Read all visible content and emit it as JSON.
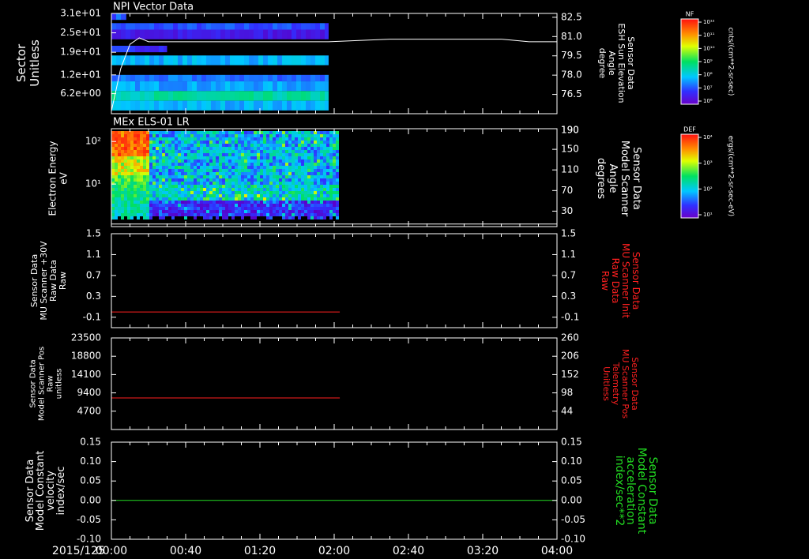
{
  "colors": {
    "background": "#000000",
    "foreground": "#ffffff",
    "red": "#ff2020",
    "green": "#22dd22"
  },
  "time_axis": {
    "date": "2015/125",
    "ticks": [
      "00:00",
      "00:40",
      "01:20",
      "02:00",
      "02:40",
      "03:20",
      "04:00"
    ],
    "range_minutes": [
      0,
      240
    ]
  },
  "chart_data": [
    {
      "type": "heatmap",
      "title": "NPI Vector Data",
      "ylabel": [
        "Sector",
        "Unitless"
      ],
      "ytick_labels": [
        "3.1e+01",
        "2.5e+01",
        "1.9e+01",
        "1.2e+01",
        "6.2e+00"
      ],
      "ytick_values": [
        31,
        25,
        19,
        12,
        6.2
      ],
      "ylim": [
        0,
        31
      ],
      "data_extent_minutes": [
        0,
        117
      ],
      "colorbar": {
        "tag": "NF",
        "label": "cnts/(cm**2-sr-sec)",
        "tick_labels": [
          "10¹²",
          "10¹¹",
          "10¹⁰",
          "10⁹",
          "10⁸",
          "10⁷",
          "10⁶"
        ]
      },
      "bands": [
        {
          "y": [
            29,
            31
          ],
          "x_end": 8,
          "level": 0.2
        },
        {
          "y": [
            24,
            28
          ],
          "x_end": 117,
          "level": 0.18
        },
        {
          "y": [
            23,
            26
          ],
          "x_end": 117,
          "level": 0.08
        },
        {
          "y": [
            19,
            21
          ],
          "x_end": 30,
          "level": 0.14
        },
        {
          "y": [
            15,
            18
          ],
          "x_end": 117,
          "level": 0.3
        },
        {
          "y": [
            10,
            12
          ],
          "x_end": 117,
          "level": 0.22
        },
        {
          "y": [
            7,
            10
          ],
          "x_end": 117,
          "level": 0.28
        },
        {
          "y": [
            4,
            7
          ],
          "x_end": 117,
          "level": 0.42
        },
        {
          "y": [
            1,
            4
          ],
          "x_end": 117,
          "level": 0.3
        }
      ],
      "secondary_series": {
        "name": [
          "Sensor Data",
          "ESH Sun Elevation",
          "Angle",
          "degree"
        ],
        "yaxis_ticks": [
          82.5,
          81.0,
          79.5,
          78.0,
          76.5
        ],
        "ylim": [
          75.0,
          82.8
        ],
        "x": [
          0,
          2,
          5,
          10,
          15,
          20,
          25,
          30,
          60,
          90,
          117,
          150,
          180,
          210,
          225,
          240
        ],
        "y": [
          75.2,
          76.5,
          78.5,
          80.4,
          80.9,
          80.6,
          80.6,
          80.6,
          80.6,
          80.6,
          80.6,
          80.8,
          80.8,
          80.8,
          80.6,
          80.6
        ]
      }
    },
    {
      "type": "heatmap",
      "title": "MEx ELS-01 LR",
      "ylabel": [
        "Electron Energy",
        "eV"
      ],
      "ylog": true,
      "ylim": [
        1,
        200
      ],
      "ytick_labels": [
        "10²",
        "10¹"
      ],
      "ytick_values": [
        100,
        10
      ],
      "data_extent_minutes": [
        0,
        122
      ],
      "colorbar": {
        "tag": "DEF",
        "label": "ergs/(cm**2-sr-sec-eV)",
        "tick_labels": [
          "10⁴",
          "10³",
          "10²",
          "10¹"
        ]
      },
      "secondary_series": {
        "name": [
          "Sensor Data",
          "Model Scanner",
          "Angle",
          "degrees"
        ],
        "yaxis_ticks": [
          190,
          150,
          110,
          70,
          30
        ],
        "ylim": [
          0,
          190
        ],
        "x": [
          0,
          240
        ],
        "y": [
          5,
          5
        ]
      }
    },
    {
      "type": "line",
      "ylabel": [
        "Sensor Data",
        "MU Scanner +30V",
        "Raw Data",
        "Raw"
      ],
      "ytick_labels": [
        "1.5",
        "1.1",
        "0.7",
        "0.3",
        "-0.1"
      ],
      "ylim": [
        -0.3,
        1.5
      ],
      "right_axis": {
        "label": [
          "Sensor Data",
          "MU Scanner Init",
          "Raw Data",
          "Raw"
        ],
        "ytick_labels": [
          "1.5",
          "1.1",
          "0.7",
          "0.3",
          "-0.1"
        ]
      },
      "series": [
        {
          "x": [
            0,
            123
          ],
          "y": [
            0.0,
            0.0
          ],
          "color": "#ff2020"
        }
      ]
    },
    {
      "type": "line",
      "ylabel": [
        "Sensor Data",
        "Model Scanner Pos",
        "Raw",
        "unitless"
      ],
      "ytick_labels": [
        "23500",
        "18800",
        "14100",
        "9400",
        "4700"
      ],
      "ylim": [
        0,
        23500
      ],
      "right_axis": {
        "label": [
          "Sensor Data",
          "MU Scanner Pos",
          "Telemetry",
          "Unitless"
        ],
        "ytick_labels": [
          "260",
          "206",
          "152",
          "98",
          "44"
        ]
      },
      "series": [
        {
          "x": [
            0,
            123
          ],
          "y": [
            8100,
            8100
          ],
          "color": "#ff2020"
        }
      ]
    },
    {
      "type": "line",
      "ylabel": [
        "Sensor Data",
        "Model Constant",
        "velocity",
        "index/sec"
      ],
      "ytick_labels": [
        "0.15",
        "0.10",
        "0.05",
        "0.00",
        "-0.05",
        "-0.10"
      ],
      "ylim": [
        -0.1,
        0.15
      ],
      "right_axis": {
        "label": [
          "Sensor Data",
          "Model Constant",
          "acceleration",
          "index/sec**2"
        ],
        "ytick_labels": [
          "0.15",
          "0.10",
          "0.05",
          "0.00",
          "-0.05",
          "-0.10"
        ]
      },
      "series": [
        {
          "x": [
            0,
            240
          ],
          "y": [
            0,
            0
          ],
          "color": "#22dd22"
        }
      ]
    }
  ]
}
